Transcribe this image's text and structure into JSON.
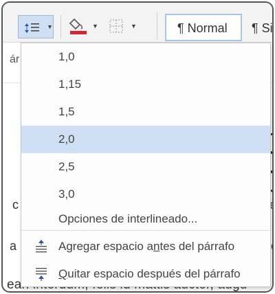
{
  "ribbon": {
    "styles": [
      {
        "label": "¶ Normal"
      },
      {
        "label": "¶ Sin"
      }
    ]
  },
  "document": {
    "top_fragment": "ár",
    "left_fragment_1": "c",
    "left_fragment_2": "a",
    "right_fragment_1": "e",
    "right_fragment_2": "o",
    "bottom_line": "ean interdum, felis id mattis auctor, augu"
  },
  "line_spacing_menu": {
    "options": [
      {
        "label": "1,0",
        "selected": false
      },
      {
        "label": "1,15",
        "selected": false
      },
      {
        "label": "1,5",
        "selected": false
      },
      {
        "label": "2,0",
        "selected": true
      },
      {
        "label": "2,5",
        "selected": false
      },
      {
        "label": "3,0",
        "selected": false
      }
    ],
    "more_options": "Opciones de interlineado...",
    "add_before": {
      "pre": "Agregar espacio a",
      "u": "n",
      "post": "tes del párrafo"
    },
    "remove_after": {
      "pre": "",
      "u": "Q",
      "post": "uitar espacio después del párrafo"
    }
  },
  "colors": {
    "selected_bg": "#cfe0f4",
    "accent_blue": "#2b579a",
    "fill_red": "#d9232e"
  },
  "icons": [
    "line-spacing-icon",
    "paint-bucket-icon",
    "borders-icon",
    "add-space-before-icon",
    "remove-space-after-icon"
  ]
}
